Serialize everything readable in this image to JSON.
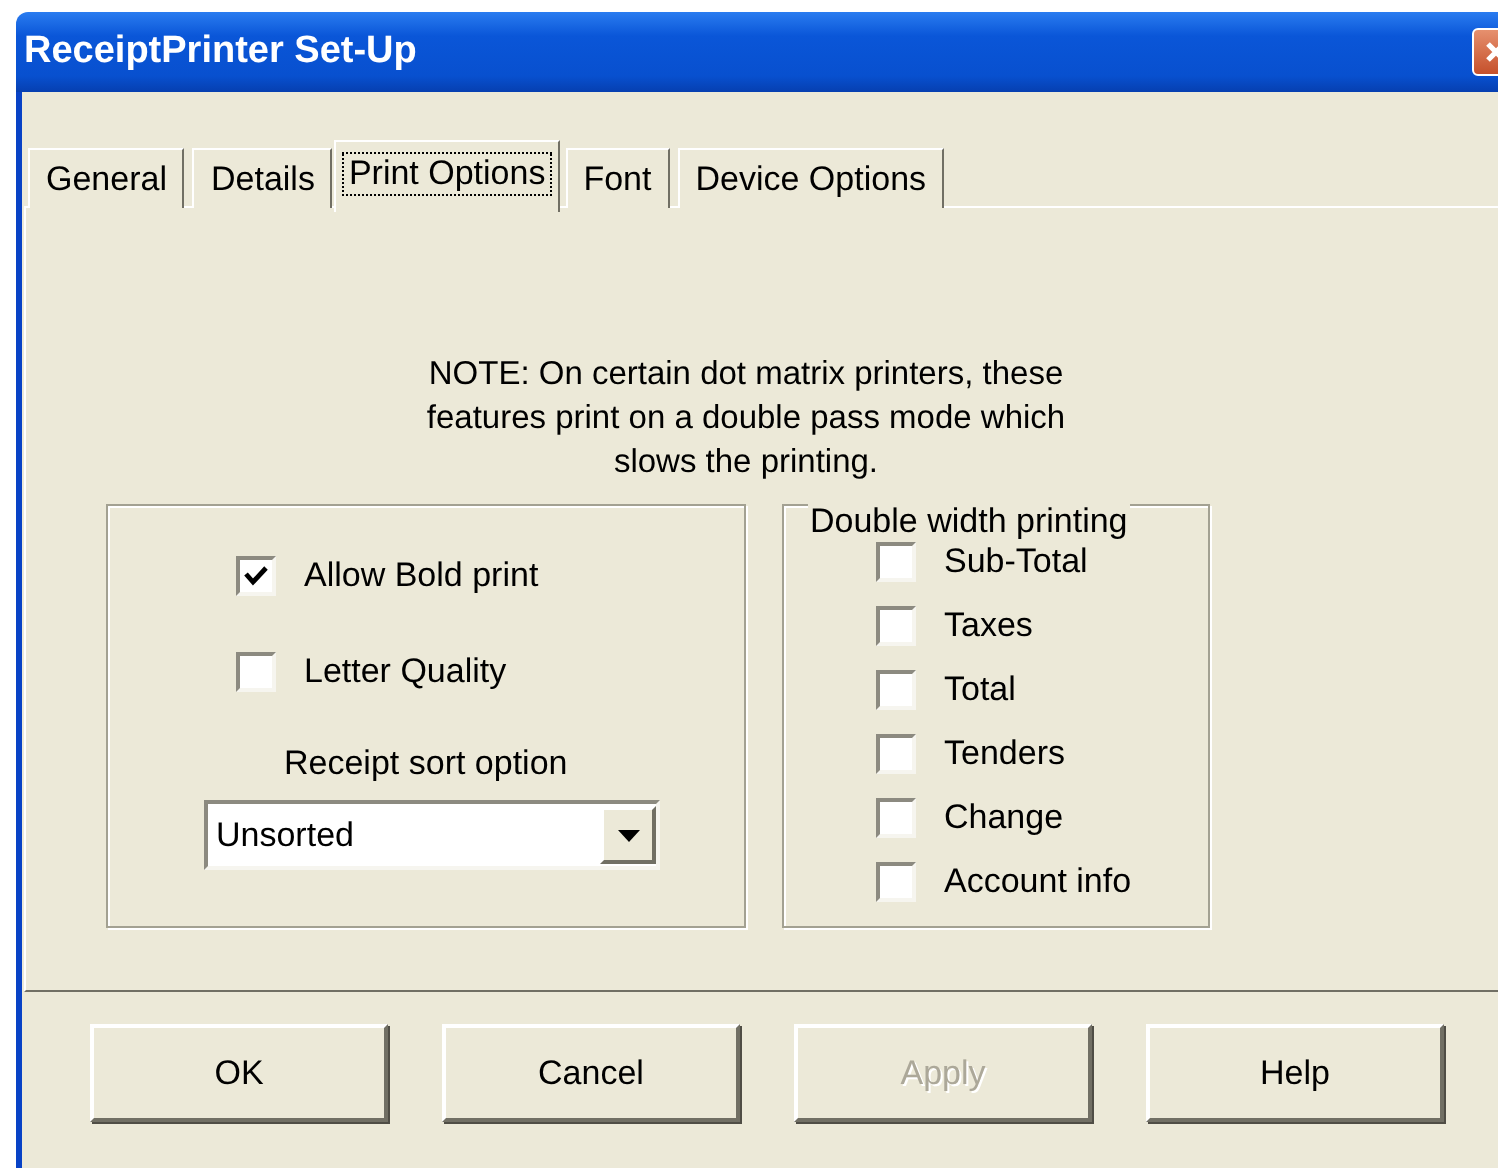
{
  "window": {
    "title": "ReceiptPrinter Set-Up"
  },
  "tabs": [
    {
      "label": "General",
      "selected": false
    },
    {
      "label": "Details",
      "selected": false
    },
    {
      "label": "Print Options",
      "selected": true
    },
    {
      "label": "Font",
      "selected": false
    },
    {
      "label": "Device Options",
      "selected": false
    }
  ],
  "note": "NOTE: On certain dot matrix printers, these\nfeatures print on a double pass mode which\nslows the printing.",
  "print_options": [
    {
      "label": "Allow Bold print",
      "checked": true
    },
    {
      "label": "Letter Quality",
      "checked": false
    }
  ],
  "sort": {
    "label": "Receipt sort option",
    "value": "Unsorted"
  },
  "double_width": {
    "title": "Double width printing",
    "items": [
      {
        "label": "Sub-Total",
        "checked": false
      },
      {
        "label": "Taxes",
        "checked": false
      },
      {
        "label": "Total",
        "checked": false
      },
      {
        "label": "Tenders",
        "checked": false
      },
      {
        "label": "Change",
        "checked": false
      },
      {
        "label": "Account info",
        "checked": false
      }
    ]
  },
  "buttons": [
    {
      "label": "OK",
      "disabled": false
    },
    {
      "label": "Cancel",
      "disabled": false
    },
    {
      "label": "Apply",
      "disabled": true
    },
    {
      "label": "Help",
      "disabled": false
    }
  ]
}
